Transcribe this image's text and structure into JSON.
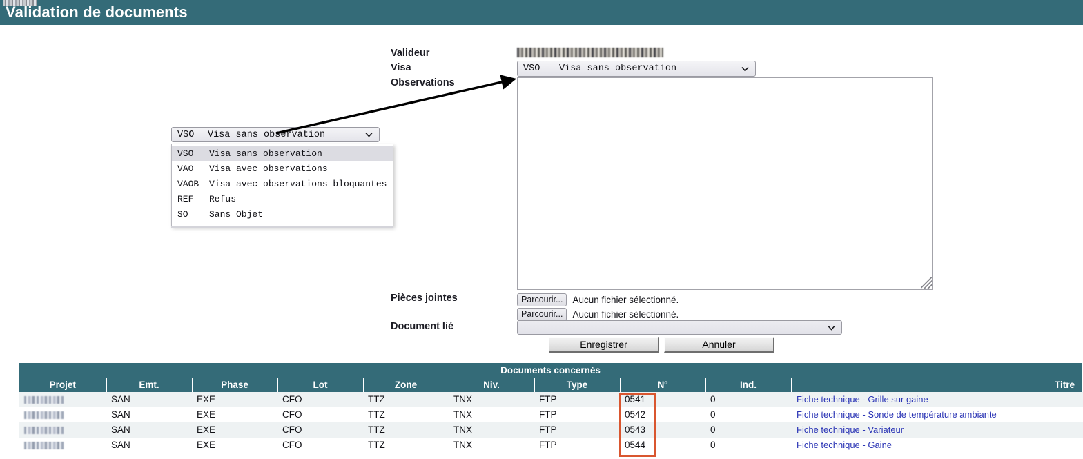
{
  "header": {
    "title": "Validation de documents",
    "accent_color": "#346b78",
    "redacted_tab": ""
  },
  "form": {
    "labels": {
      "valideur": "Valideur",
      "visa": "Visa",
      "observations": "Observations",
      "pieces_jointes": "Pièces jointes",
      "document_lie": "Document lié"
    },
    "valideur_value_redacted": "",
    "visa": {
      "selected_code": "VSO",
      "selected_label": "Visa sans observation",
      "options": [
        {
          "code": "VSO",
          "label": "Visa sans observation"
        },
        {
          "code": "VAO",
          "label": "Visa avec observations"
        },
        {
          "code": "VAOB",
          "label": "Visa avec observations bloquantes"
        },
        {
          "code": "REF",
          "label": "Refus"
        },
        {
          "code": "SO",
          "label": "Sans Objet"
        }
      ]
    },
    "observations": {
      "value": "",
      "placeholder": ""
    },
    "attachments": [
      {
        "button_label": "Parcourir...",
        "status": "Aucun fichier sélectionné."
      },
      {
        "button_label": "Parcourir...",
        "status": "Aucun fichier sélectionné."
      }
    ],
    "document_lie": {
      "selected_label": "",
      "options": []
    },
    "buttons": {
      "save": "Enregistrer",
      "cancel": "Annuler"
    }
  },
  "annotations": {
    "highlight_color": "#d9562f",
    "arrow_color": "#000000"
  },
  "documents_table": {
    "title": "Documents concernés",
    "columns": [
      "Projet",
      "Emt.",
      "Phase",
      "Lot",
      "Zone",
      "Niv.",
      "Type",
      "Nº",
      "Ind.",
      "Titre"
    ],
    "rows": [
      {
        "projet": "",
        "emt": "SAN",
        "phase": "EXE",
        "lot": "CFO",
        "zone": "TTZ",
        "niv": "TNX",
        "type": "FTP",
        "no": "0541",
        "ind": "0",
        "titre": "Fiche technique - Grille sur gaine"
      },
      {
        "projet": "",
        "emt": "SAN",
        "phase": "EXE",
        "lot": "CFO",
        "zone": "TTZ",
        "niv": "TNX",
        "type": "FTP",
        "no": "0542",
        "ind": "0",
        "titre": "Fiche technique - Sonde de température ambiante"
      },
      {
        "projet": "",
        "emt": "SAN",
        "phase": "EXE",
        "lot": "CFO",
        "zone": "TTZ",
        "niv": "TNX",
        "type": "FTP",
        "no": "0543",
        "ind": "0",
        "titre": "Fiche technique - Variateur"
      },
      {
        "projet": "",
        "emt": "SAN",
        "phase": "EXE",
        "lot": "CFO",
        "zone": "TTZ",
        "niv": "TNX",
        "type": "FTP",
        "no": "0544",
        "ind": "0",
        "titre": "Fiche technique - Gaine"
      }
    ],
    "link_color": "#2b35b5",
    "header_color": "#346b78",
    "stripe_color": "#eef2f3"
  }
}
